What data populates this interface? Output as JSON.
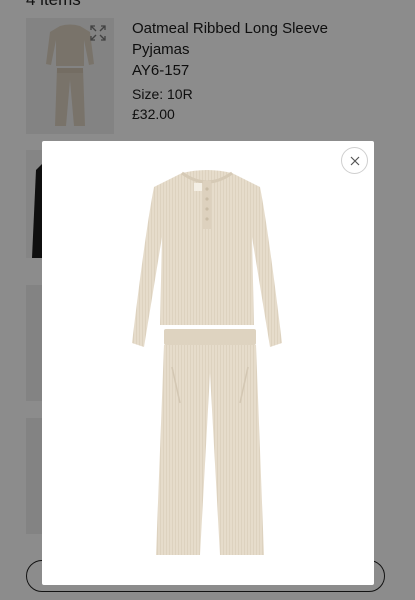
{
  "basket": {
    "items_count": "4 items"
  },
  "product": {
    "title": "Oatmeal Ribbed Long Sleeve Pyjamas",
    "code": "AY6-157",
    "size": "Size: 10R",
    "price": "£32.00"
  },
  "icons": {
    "expand": "expand-icon",
    "close": "close-icon"
  },
  "colors": {
    "overlay": "#000000",
    "garment": "#e4dac9"
  }
}
